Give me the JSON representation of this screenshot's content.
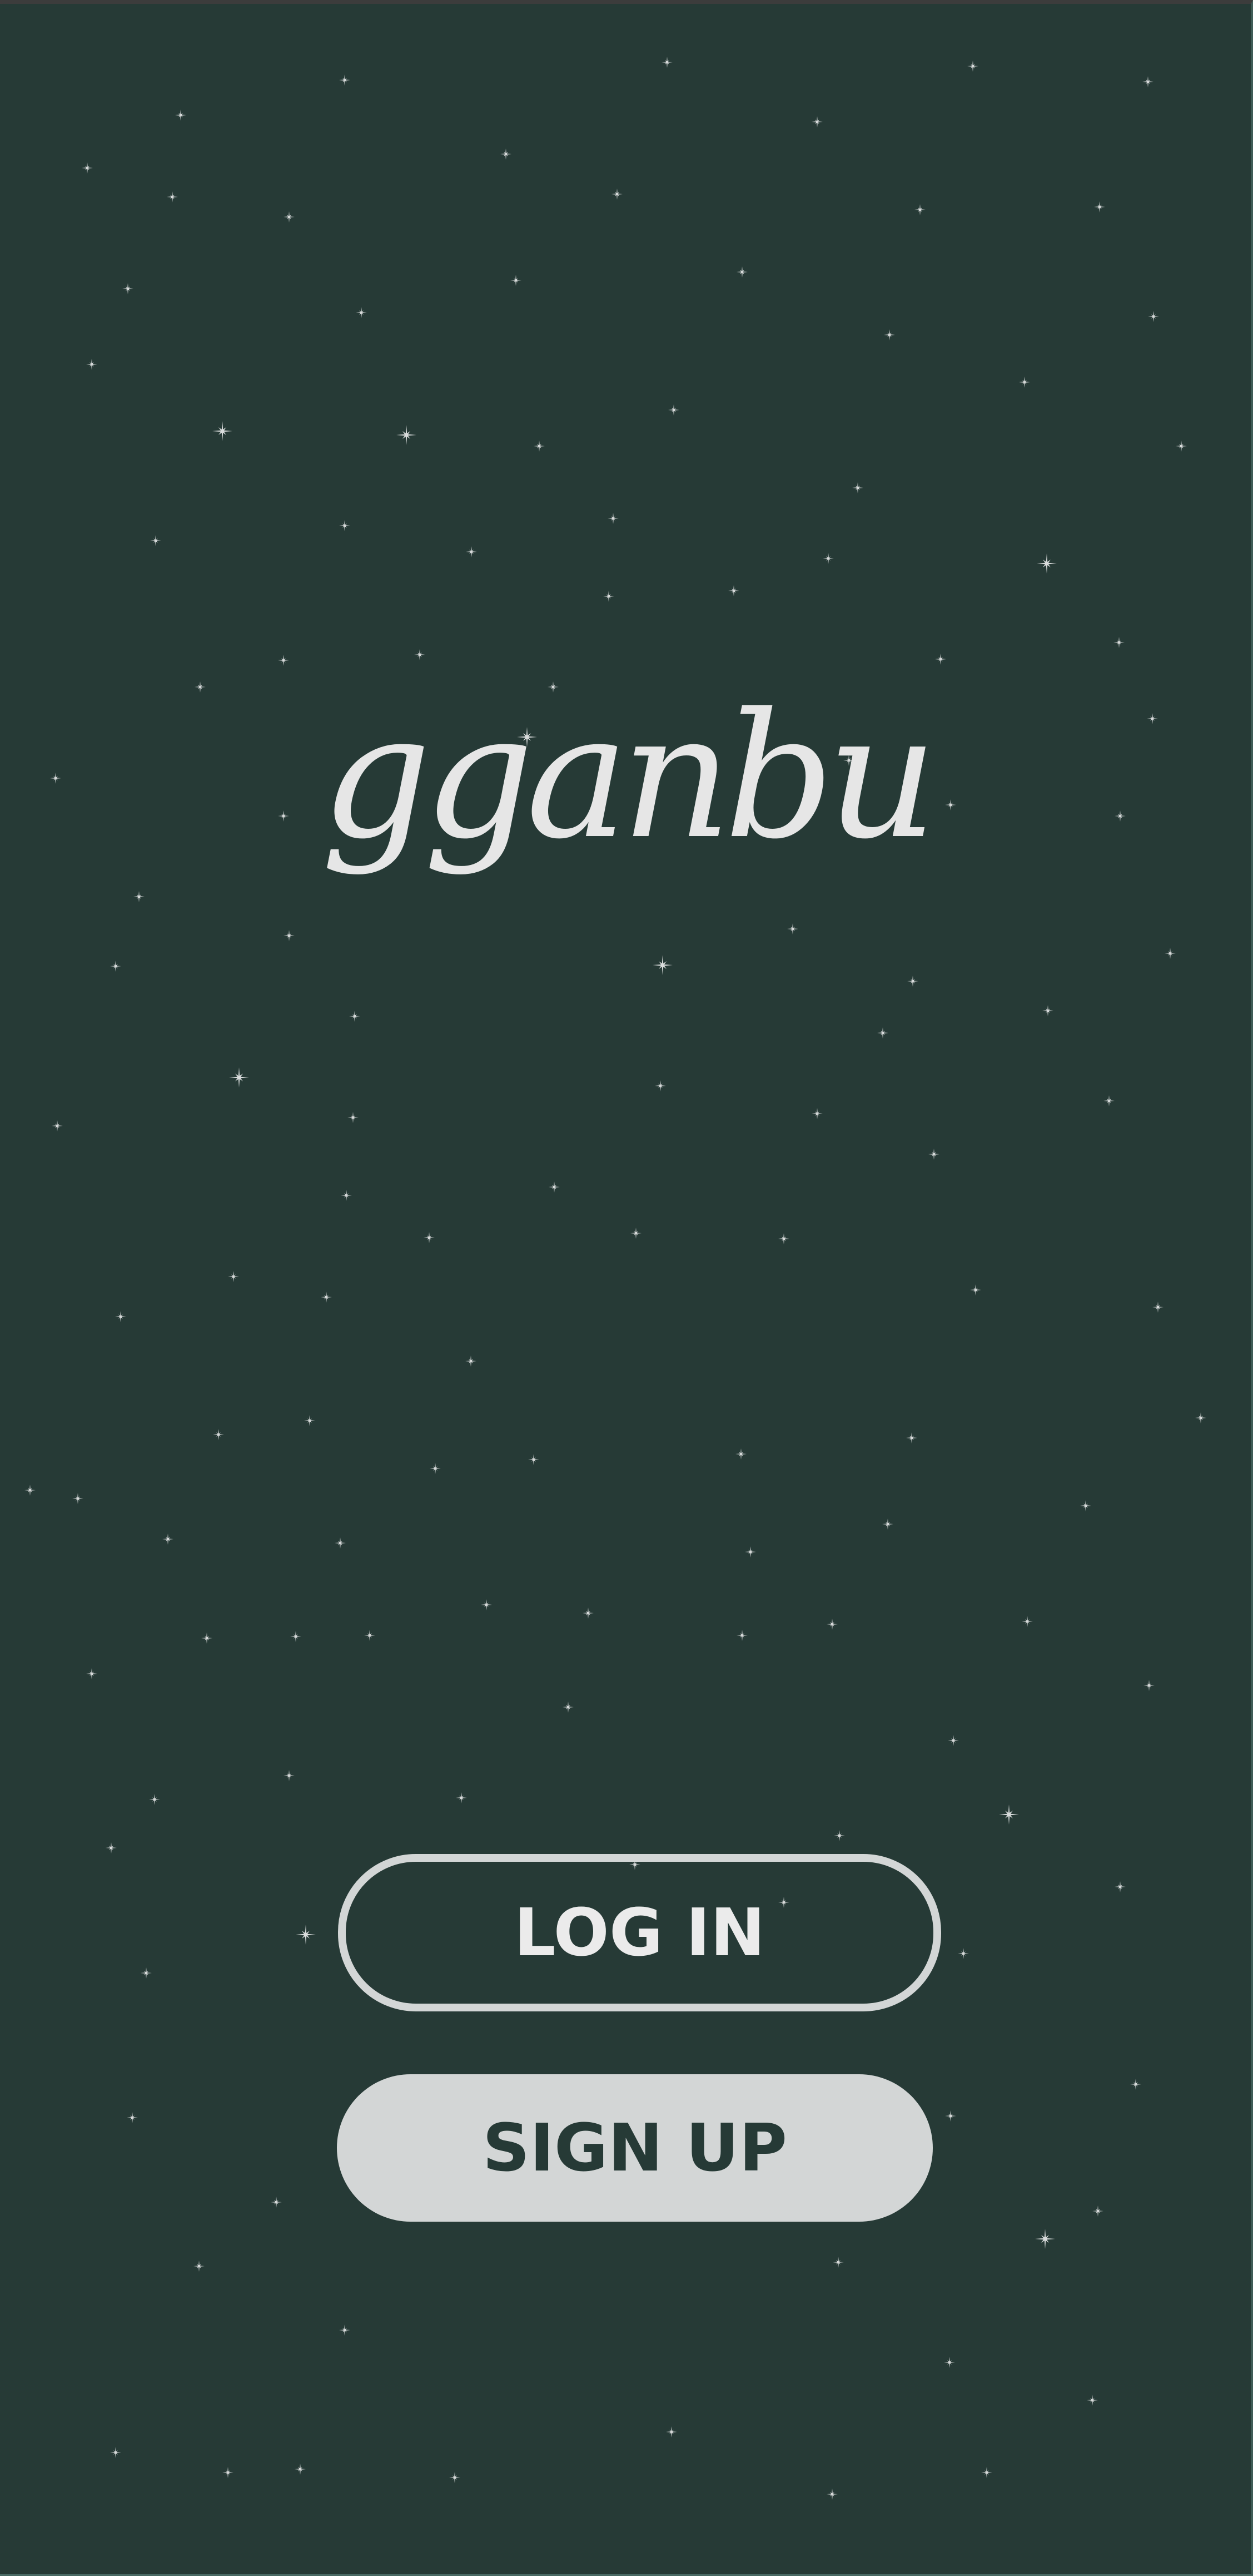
{
  "app": {
    "logo_text": "gganbu"
  },
  "actions": {
    "login_label": "LOG IN",
    "signup_label": "SIGN UP"
  },
  "theme": {
    "background": "#263a36",
    "star": "#d9dcdc",
    "button_light": "#d3d6d6",
    "button_dark_text": "#263a36"
  }
}
